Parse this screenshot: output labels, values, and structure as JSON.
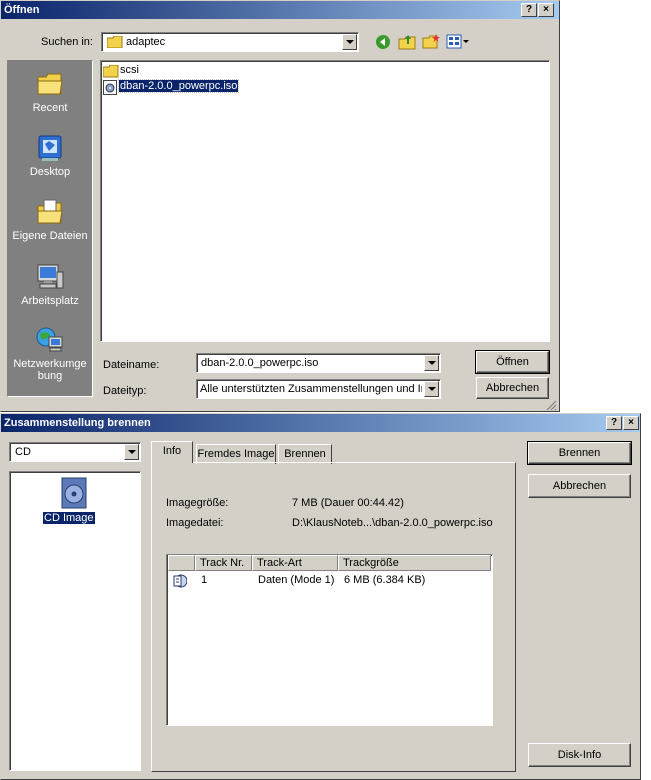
{
  "open_dialog": {
    "title": "Öffnen",
    "help_button": "?",
    "close_button": "×",
    "look_in_label": "Suchen in:",
    "look_in_value": "adaptec",
    "places": [
      {
        "label": "Recent",
        "icon": "recent-folder-icon"
      },
      {
        "label": "Desktop",
        "icon": "desktop-icon"
      },
      {
        "label": "Eigene Dateien",
        "icon": "my-documents-icon"
      },
      {
        "label": "Arbeitsplatz",
        "icon": "my-computer-icon"
      },
      {
        "label": "Netzwerkumgebung",
        "label_line1": "Netzwerkumge",
        "label_line2": "bung",
        "icon": "network-icon"
      }
    ],
    "files": [
      {
        "name": "scsi",
        "icon": "folder-icon",
        "selected": false
      },
      {
        "name": "dban-2.0.0_powerpc.iso",
        "icon": "iso-file-icon",
        "selected": true
      }
    ],
    "filename_label": "Dateiname:",
    "filename_value": "dban-2.0.0_powerpc.iso",
    "filetype_label": "Dateityp:",
    "filetype_value": "Alle unterstützten Zusammenstellungen und Ima",
    "open_button": "Öffnen",
    "cancel_button": "Abbrechen"
  },
  "burn_dialog": {
    "title": "Zusammenstellung brennen",
    "help_button": "?",
    "close_button": "×",
    "media_select": "CD",
    "compilation_item": "CD Image",
    "tabs": [
      "Info",
      "Fremdes Image",
      "Brennen"
    ],
    "active_tab": "Info",
    "info": {
      "image_size_label": "Imagegröße:",
      "image_size_value": "7 MB (Dauer 00:44.42)",
      "image_file_label": "Imagedatei:",
      "image_file_value": "D:\\KlausNoteb...\\dban-2.0.0_powerpc.iso"
    },
    "track_table": {
      "columns": [
        "",
        "Track Nr.",
        "Track-Art",
        "Trackgröße"
      ],
      "rows": [
        {
          "track": "1",
          "type": "Daten (Mode 1)",
          "size": "6 MB (6.384 KB)"
        }
      ]
    },
    "burn_button": "Brennen",
    "cancel_button": "Abbrechen",
    "disk_info_button": "Disk-Info"
  }
}
